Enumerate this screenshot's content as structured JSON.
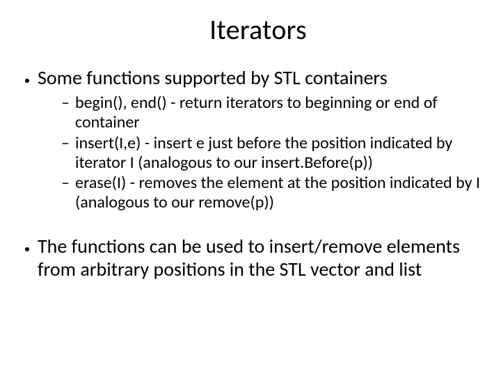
{
  "title": "Iterators",
  "bullets": {
    "b1": "Some functions supported by STL containers",
    "b1_subs": {
      "s1": "begin(), end() - return iterators to beginning or end of container",
      "s2": "insert(I,e) - insert e just before the position indicated by iterator I (analogous to our insert.Before(p))",
      "s3": "erase(I) - removes the element at the position indicated by I (analogous to our remove(p))"
    },
    "b2": "The functions can be used to insert/remove elements from arbitrary positions in the STL vector and list"
  }
}
